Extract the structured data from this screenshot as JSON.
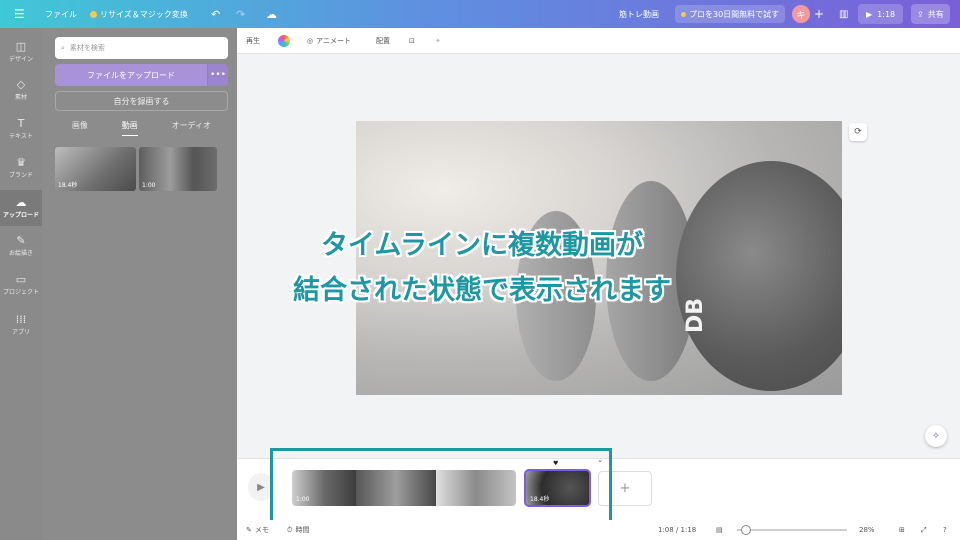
{
  "topbar": {
    "menu_icon": "menu-icon",
    "file": "ファイル",
    "resize": "リサイズ＆マジック変換",
    "title": "筋トレ動画",
    "pro_trial": "プロを30日間無料で試す",
    "avatar": "キ",
    "duration": "1:18",
    "share": "共有",
    "brand_color": "#5f8fe0"
  },
  "rail": {
    "items": [
      {
        "label": "デザイン",
        "icon": "design-icon"
      },
      {
        "label": "素材",
        "icon": "elements-icon"
      },
      {
        "label": "テキスト",
        "icon": "text-icon"
      },
      {
        "label": "ブランド",
        "icon": "brand-icon"
      },
      {
        "label": "アップロード",
        "icon": "upload-icon"
      },
      {
        "label": "お絵描き",
        "icon": "draw-icon"
      },
      {
        "label": "プロジェクト",
        "icon": "folder-icon"
      },
      {
        "label": "アプリ",
        "icon": "apps-icon"
      }
    ],
    "active": "アップロード"
  },
  "panel": {
    "search_placeholder": "素材を検索",
    "upload_button": "ファイルをアップロード",
    "more_button": "•••",
    "record_button": "自分を録画する",
    "tabs": [
      "画像",
      "動画",
      "オーディオ"
    ],
    "active_tab": "動画",
    "thumbnails": [
      {
        "label": "18.4秒"
      },
      {
        "label": "1:00"
      }
    ]
  },
  "canvas_toolbar": {
    "playback": "再生",
    "animate": "アニメート",
    "position": "配置"
  },
  "canvas": {
    "frame_text": "DB"
  },
  "overlay": {
    "line1": "タイムラインに複数動画が",
    "line2": "結合された状態で表示されます",
    "color": "#1d97a4"
  },
  "timeline": {
    "clips": [
      {
        "label": "1:00"
      },
      {
        "label": ""
      },
      {
        "label": ""
      }
    ],
    "selected_clip_label": "18.4秒",
    "add_symbol": "+"
  },
  "bottombar": {
    "notes": "メモ",
    "timer": "時間",
    "time": "1:08 / 1:18",
    "zoom": "28%"
  }
}
